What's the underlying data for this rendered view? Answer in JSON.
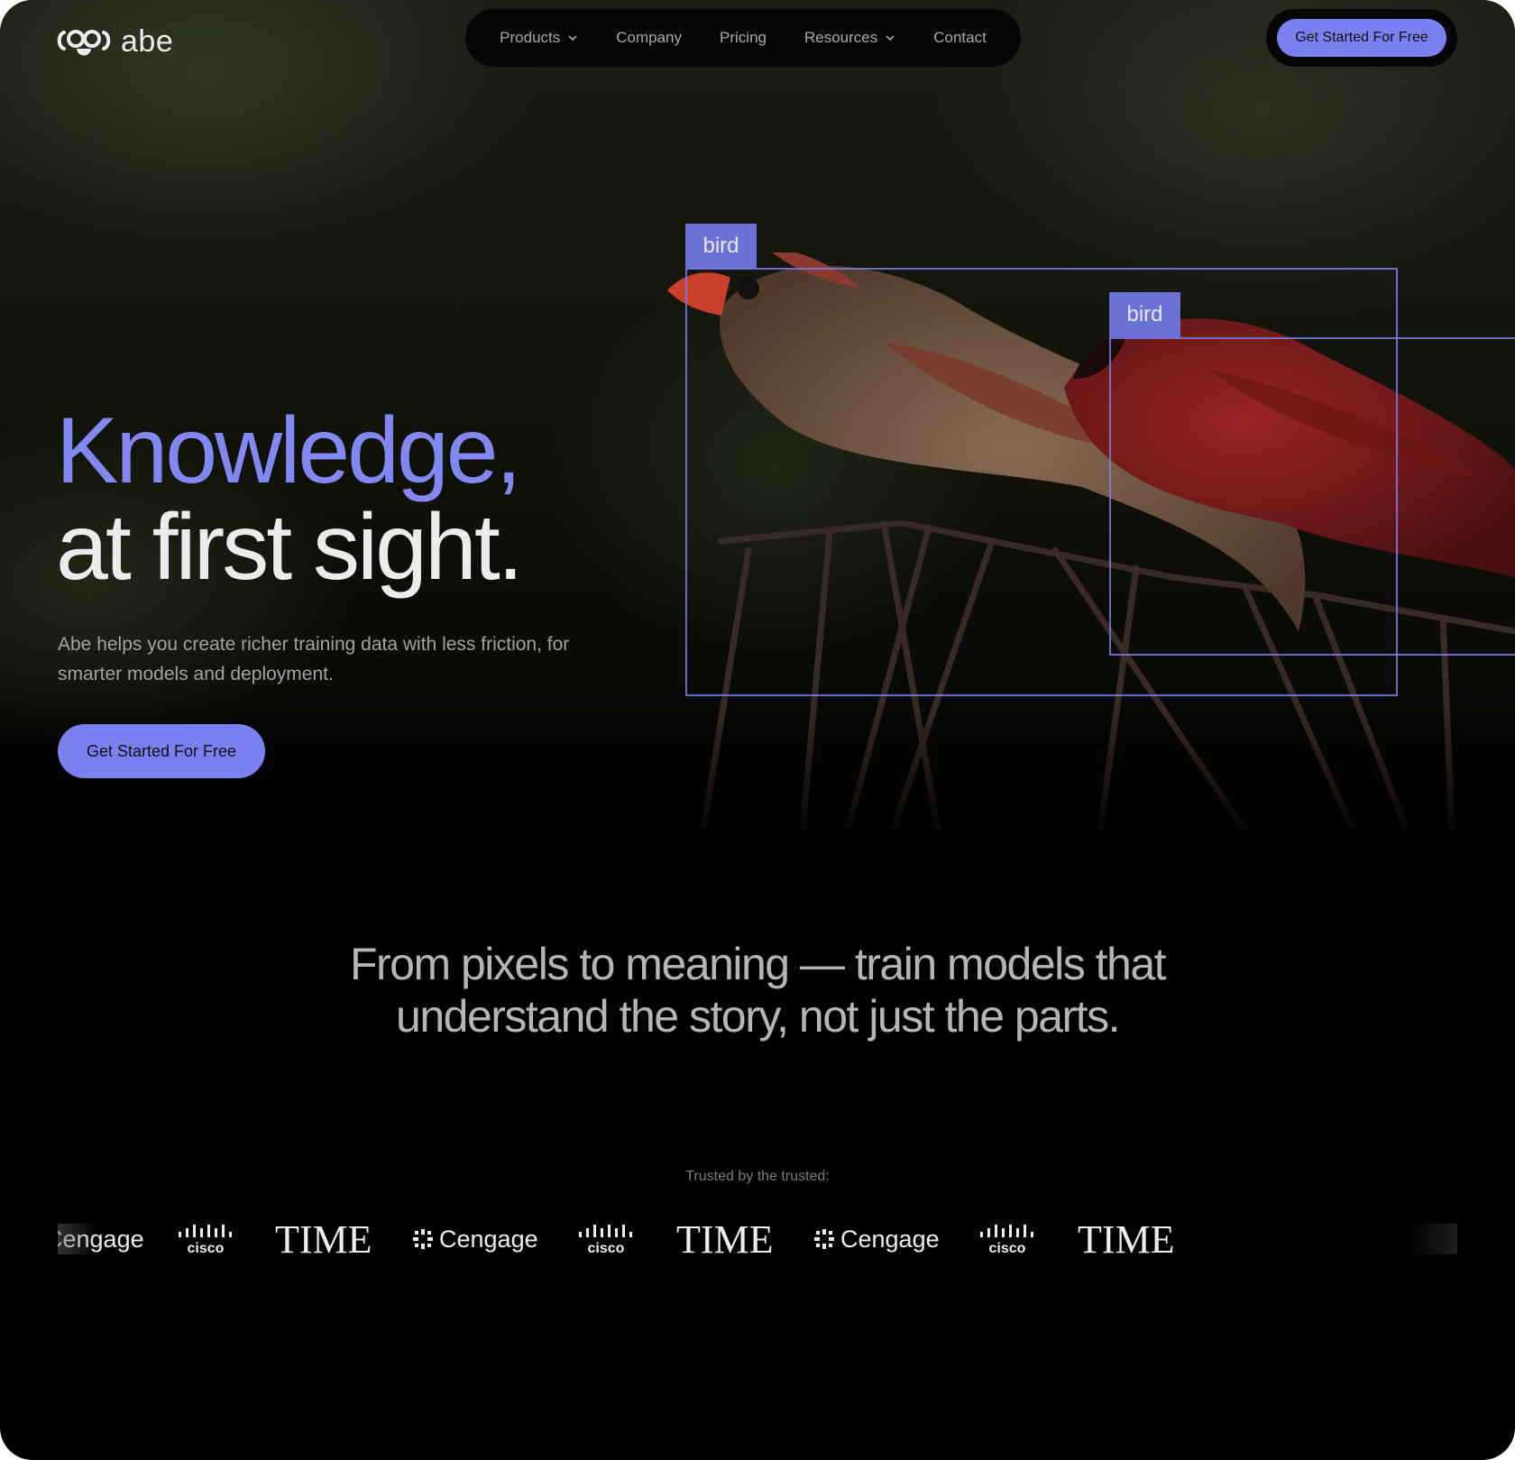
{
  "brand": {
    "name": "abe"
  },
  "nav": {
    "items": [
      {
        "label": "Products",
        "has_dropdown": true
      },
      {
        "label": "Company",
        "has_dropdown": false
      },
      {
        "label": "Pricing",
        "has_dropdown": false
      },
      {
        "label": "Resources",
        "has_dropdown": true
      },
      {
        "label": "Contact",
        "has_dropdown": false
      }
    ],
    "cta_label": "Get Started For Free"
  },
  "hero": {
    "headline_line1": "Knowledge,",
    "headline_line2": "at first sight.",
    "subtitle": "Abe helps you create richer training data with less friction, for smarter models and deployment.",
    "cta_label": "Get Started For Free",
    "detections": [
      {
        "label": "bird"
      },
      {
        "label": "bird"
      }
    ]
  },
  "tagline": "From pixels to meaning — train models that understand the story, not just the parts.",
  "trusted": {
    "heading": "Trusted by the trusted:",
    "logos": [
      "Cengage",
      "cisco",
      "TIME",
      "Cengage",
      "cisco",
      "TIME",
      "Cengage",
      "cisco",
      "TIME"
    ]
  },
  "colors": {
    "accent": "#7a80f0",
    "headline_accent": "#8288f2",
    "background": "#000000",
    "bbox": "#6c71d6"
  }
}
